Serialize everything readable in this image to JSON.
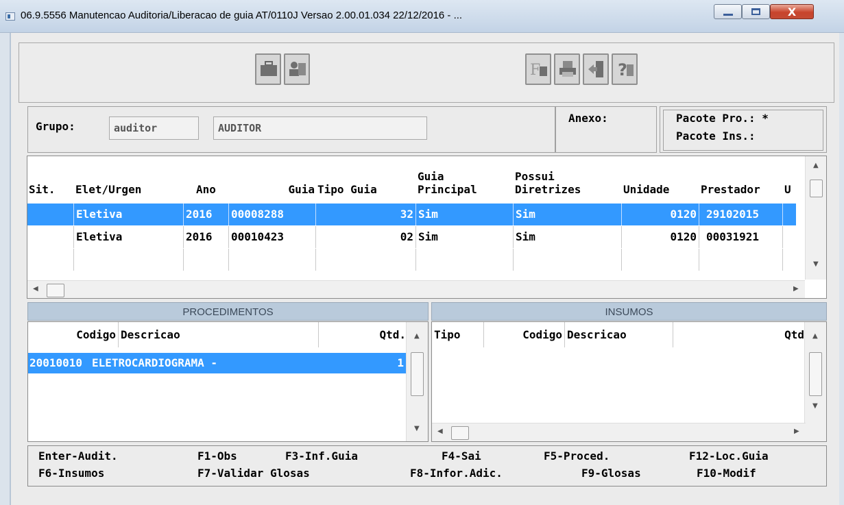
{
  "window": {
    "title": "06.9.5556 Manutencao  Auditoria/Liberacao de guia AT/0110J Versao 2.00.01.034 22/12/2016 - ...",
    "close_label": "X"
  },
  "toolbar": {
    "icons": [
      "briefcase-icon",
      "user-card-icon",
      "font-icon",
      "print-icon",
      "exit-door-icon",
      "help-icon"
    ]
  },
  "grupo": {
    "label": "Grupo:",
    "code": "auditor",
    "name": "AUDITOR"
  },
  "anexo": {
    "label": "Anexo:"
  },
  "pacote": {
    "pro": "Pacote Pro.: *",
    "ins": "Pacote Ins.:"
  },
  "guides": {
    "columns": [
      "Sit.",
      "Elet/Urgen",
      "Ano",
      "Guia",
      "Tipo Guia",
      "Guia\nPrincipal",
      "Possui\nDiretrizes",
      "Unidade",
      "Prestador",
      "U"
    ],
    "rows": [
      [
        "",
        "Eletiva",
        "2016",
        "00008288",
        "32",
        "Sim",
        "Sim",
        "0120",
        "29102015"
      ],
      [
        "",
        "Eletiva",
        "2016",
        "00010423",
        "02",
        "Sim",
        "Sim",
        "0120",
        "00031921"
      ]
    ]
  },
  "procedimentos": {
    "title": "PROCEDIMENTOS",
    "columns": [
      "Codigo",
      "Descricao",
      "Qtd."
    ],
    "rows": [
      [
        "20010010",
        "ELETROCARDIOGRAMA -",
        "1"
      ]
    ]
  },
  "insumos": {
    "title": "INSUMOS",
    "columns": [
      "Tipo",
      "Codigo",
      "Descricao",
      "Qtd"
    ]
  },
  "keys": {
    "row1": [
      "Enter-Audit.",
      "F1-Obs",
      "F3-Inf.Guia",
      "F4-Sai",
      "F5-Proced.",
      "F12-Loc.Guia"
    ],
    "row2": [
      "F6-Insumos",
      "F7-Validar Glosas",
      "F8-Infor.Adic.",
      "F9-Glosas",
      "F10-Modif"
    ]
  }
}
